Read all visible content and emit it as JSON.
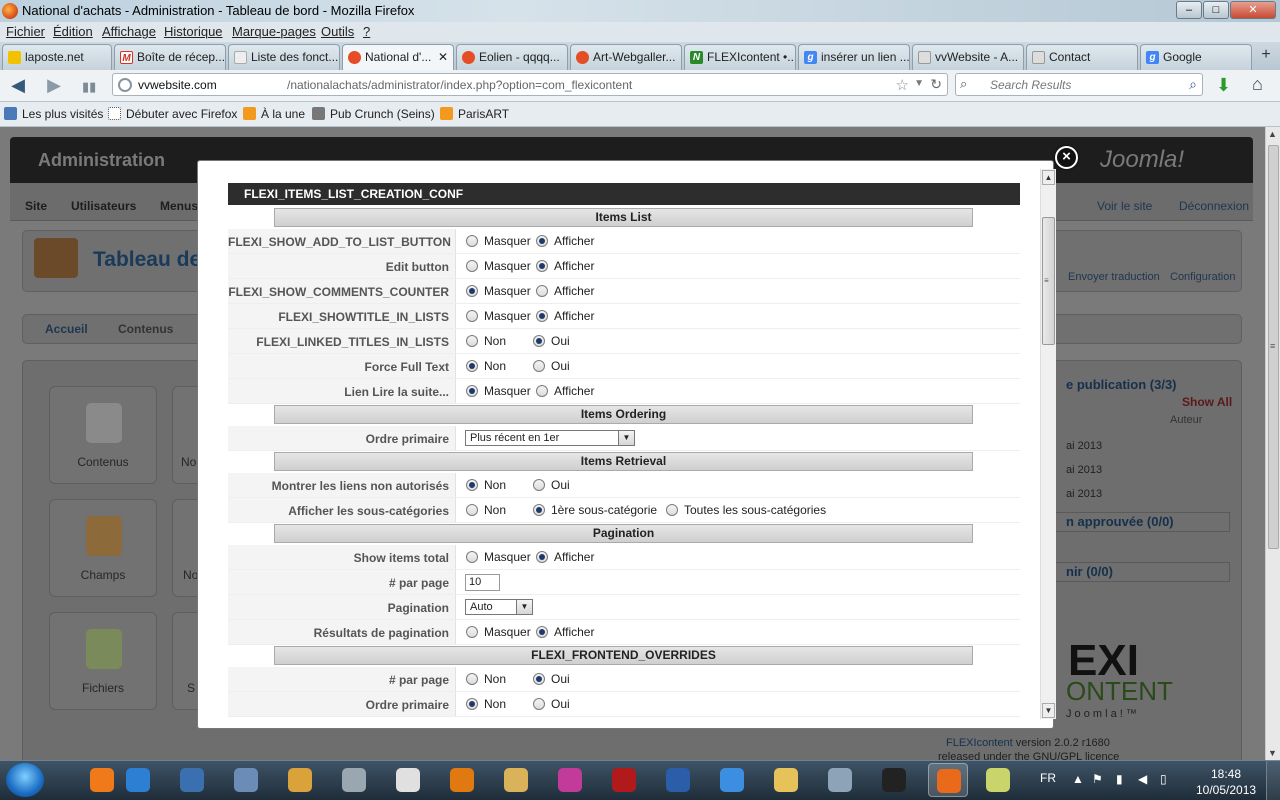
{
  "window": {
    "title": "National d'achats - Administration - Tableau de bord - Mozilla Firefox",
    "min": "‒",
    "max": "□",
    "close": "✕"
  },
  "menubar": [
    "Fichier",
    "Édition",
    "Affichage",
    "Historique",
    "Marque-pages",
    "Outils",
    "?"
  ],
  "tabs": [
    {
      "label": "laposte.net",
      "icon_color": "#f2c200"
    },
    {
      "label": "Boîte de récep...",
      "icon_color": "#d93025"
    },
    {
      "label": "Liste des fonct...",
      "icon_color": "#cccccc"
    },
    {
      "label": "National d'...",
      "icon_color": "#e44d26",
      "active": true
    },
    {
      "label": "Eolien - qqqq...",
      "icon_color": "#e44d26"
    },
    {
      "label": "Art-Webgaller...",
      "icon_color": "#e44d26"
    },
    {
      "label": "FLEXIcontent •...",
      "icon_color": "#2a8a2a"
    },
    {
      "label": "insérer un lien ...",
      "icon_color": "#4285f4"
    },
    {
      "label": "vvWebsite - A...",
      "icon_color": "#999999"
    },
    {
      "label": "Contact",
      "icon_color": "#999999"
    },
    {
      "label": "Google",
      "icon_color": "#4285f4"
    }
  ],
  "newtab": "+",
  "nav": {
    "back": "◀",
    "forward": "▶",
    "signal": "▮▮",
    "url_host": "vvwebsite.com",
    "url_path": "/nationalachats/administrator/index.php?option=com_flexicontent",
    "star": "☆",
    "dropdown": "▼",
    "reload": "↻",
    "search_placeholder": "Search Results",
    "search_engine_icon": "⌕",
    "search_go": "⌕",
    "download": "⬇",
    "home": "⌂"
  },
  "bookmarks": [
    {
      "label": "Les plus visités",
      "icon_color": "#4a79b8"
    },
    {
      "label": "Débuter avec Firefox",
      "icon_color": "#ffffff"
    },
    {
      "label": "À la une",
      "icon_color": "#f39a1e"
    },
    {
      "label": "Pub Crunch (Seins)",
      "icon_color": "#777777"
    },
    {
      "label": "ParisART",
      "icon_color": "#f39a1e"
    }
  ],
  "admin": {
    "title": "Administration",
    "logo": "Joomla!",
    "menu": [
      "Site",
      "Utilisateurs",
      "Menus"
    ],
    "view_site": "Voir le site",
    "logout": "Déconnexion",
    "dashboard_title": "Tableau de",
    "tabs": [
      "Accueil",
      "Contenus"
    ],
    "cards": [
      "Contenus",
      "Champs",
      "Fichiers"
    ],
    "cards_cut": [
      "No",
      "No",
      "S"
    ],
    "toolbar": [
      "Envoyer traduction",
      "Configuration"
    ],
    "pending": "e publication (3/3)",
    "show_all": "Show All",
    "author_col": "Auteur",
    "dates": [
      "ai 2013",
      "ai 2013",
      "ai 2013"
    ],
    "approved": "n approuvée (0/0)",
    "expire": "nir (0/0)",
    "brand_big": "EXI",
    "brand_sub": "ONTENT",
    "brand_tag": "J o o m l a ! ™",
    "version_link": "FLEXIcontent",
    "version": " version 2.0.2 r1680",
    "licence": "released under the GNU/GPL licence"
  },
  "modal": {
    "close": "×",
    "header": "FLEXI_ITEMS_LIST_CREATION_CONF",
    "sections": {
      "items_list": "Items List",
      "items_ordering": "Items Ordering",
      "items_retrieval": "Items Retrieval",
      "pagination": "Pagination",
      "overrides": "FLEXI_FRONTEND_OVERRIDES"
    },
    "rows": {
      "show_add_to_list": {
        "label": "FLEXI_SHOW_ADD_TO_LIST_BUTTON",
        "opt1": "Masquer",
        "opt2": "Afficher",
        "value": "Afficher"
      },
      "edit_button": {
        "label": "Edit button",
        "opt1": "Masquer",
        "opt2": "Afficher",
        "value": "Afficher"
      },
      "comments_counter": {
        "label": "FLEXI_SHOW_COMMENTS_COUNTER",
        "opt1": "Masquer",
        "opt2": "Afficher",
        "value": "Masquer"
      },
      "showtitle": {
        "label": "FLEXI_SHOWTITLE_IN_LISTS",
        "opt1": "Masquer",
        "opt2": "Afficher",
        "value": "Afficher"
      },
      "linked_titles": {
        "label": "FLEXI_LINKED_TITLES_IN_LISTS",
        "opt1": "Non",
        "opt2": "Oui",
        "value": "Oui"
      },
      "force_full_text": {
        "label": "Force Full Text",
        "opt1": "Non",
        "opt2": "Oui",
        "value": "Non"
      },
      "read_more": {
        "label": "Lien Lire la suite...",
        "opt1": "Masquer",
        "opt2": "Afficher",
        "value": "Masquer"
      },
      "primary_order": {
        "label": "Ordre primaire",
        "value": "Plus récent en 1er",
        "arrow": "▼"
      },
      "unauth_links": {
        "label": "Montrer les liens non autorisés",
        "opt1": "Non",
        "opt2": "Oui",
        "value": "Non"
      },
      "subcats": {
        "label": "Afficher les sous-catégories",
        "opt1": "Non",
        "opt2": "1ère sous-catégorie",
        "opt3": "Toutes les sous-catégories",
        "value": "1ère sous-catégorie"
      },
      "show_total": {
        "label": "Show items total",
        "opt1": "Masquer",
        "opt2": "Afficher",
        "value": "Afficher"
      },
      "per_page": {
        "label": "# par page",
        "value": "10"
      },
      "pagination": {
        "label": "Pagination",
        "value": "Auto",
        "arrow": "▼"
      },
      "page_results": {
        "label": "Résultats de pagination",
        "opt1": "Masquer",
        "opt2": "Afficher",
        "value": "Afficher"
      },
      "ov_per_page": {
        "label": "# par page",
        "opt1": "Non",
        "opt2": "Oui",
        "value": "Oui"
      },
      "ov_primary_order": {
        "label": "Ordre primaire",
        "opt1": "Non",
        "opt2": "Oui",
        "value": "Non"
      }
    },
    "scroll_up": "▲",
    "scroll_down": "▼"
  },
  "taskbar": {
    "apps": [
      {
        "name": "avast",
        "color": "#f07a1a"
      },
      {
        "name": "media",
        "color": "#2d7fd4"
      },
      {
        "name": "outlook",
        "color": "#3a6fb0"
      },
      {
        "name": "excel-like",
        "color": "#6c8cb8"
      },
      {
        "name": "package",
        "color": "#d9a23a"
      },
      {
        "name": "scanner",
        "color": "#9aa7b1"
      },
      {
        "name": "pdf24",
        "color": "#e0e0e0"
      },
      {
        "name": "app-orange",
        "color": "#e07a10"
      },
      {
        "name": "paint",
        "color": "#d9b25a"
      },
      {
        "name": "app-pink",
        "color": "#c23a9a"
      },
      {
        "name": "filezilla",
        "color": "#b01a1a"
      },
      {
        "name": "word",
        "color": "#2a5ea8"
      },
      {
        "name": "ie",
        "color": "#3b8ee0"
      },
      {
        "name": "explorer",
        "color": "#e6c25a"
      },
      {
        "name": "calculator",
        "color": "#8ca3b8"
      },
      {
        "name": "blackberry",
        "color": "#222222"
      },
      {
        "name": "firefox",
        "color": "#e86a1a",
        "active": true
      },
      {
        "name": "paint2",
        "color": "#c9d46a"
      }
    ],
    "lang": "FR",
    "time": "18:48",
    "date": "10/05/2013"
  }
}
